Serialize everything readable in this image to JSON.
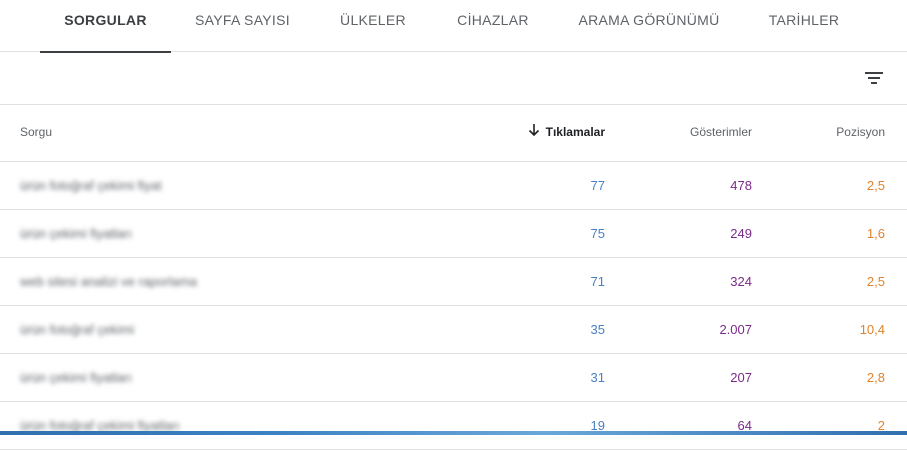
{
  "tabs": [
    {
      "label": "SORGULAR",
      "active": true
    },
    {
      "label": "SAYFA SAYISI",
      "active": false
    },
    {
      "label": "ÜLKELER",
      "active": false
    },
    {
      "label": "CİHAZLAR",
      "active": false
    },
    {
      "label": "ARAMA GÖRÜNÜMÜ",
      "active": false
    },
    {
      "label": "TARİHLER",
      "active": false
    }
  ],
  "table": {
    "columns": {
      "query": "Sorgu",
      "clicks": "Tıklamalar",
      "impressions": "Gösterimler",
      "position": "Pozisyon"
    },
    "sort_column": "clicks",
    "rows": [
      {
        "query": "ürün fotoğraf çekimi fiyat",
        "clicks": "77",
        "impressions": "478",
        "position": "2,5"
      },
      {
        "query": "ürün çekimi fiyatları",
        "clicks": "75",
        "impressions": "249",
        "position": "1,6"
      },
      {
        "query": "web sitesi analizi ve raporlama",
        "clicks": "71",
        "impressions": "324",
        "position": "2,5"
      },
      {
        "query": "ürün fotoğraf çekimi",
        "clicks": "35",
        "impressions": "2.007",
        "position": "10,4"
      },
      {
        "query": "ürün çekimi fiyatları",
        "clicks": "31",
        "impressions": "207",
        "position": "2,8"
      },
      {
        "query": "ürün fotoğraf çekimi fiyatları",
        "clicks": "19",
        "impressions": "64",
        "position": "2"
      }
    ]
  },
  "icons": {
    "filter": "filter-icon",
    "sort": "arrow-down-icon"
  },
  "colors": {
    "clicks": "#4a7fc1",
    "impressions": "#7b2a8a",
    "position": "#e0822c"
  }
}
